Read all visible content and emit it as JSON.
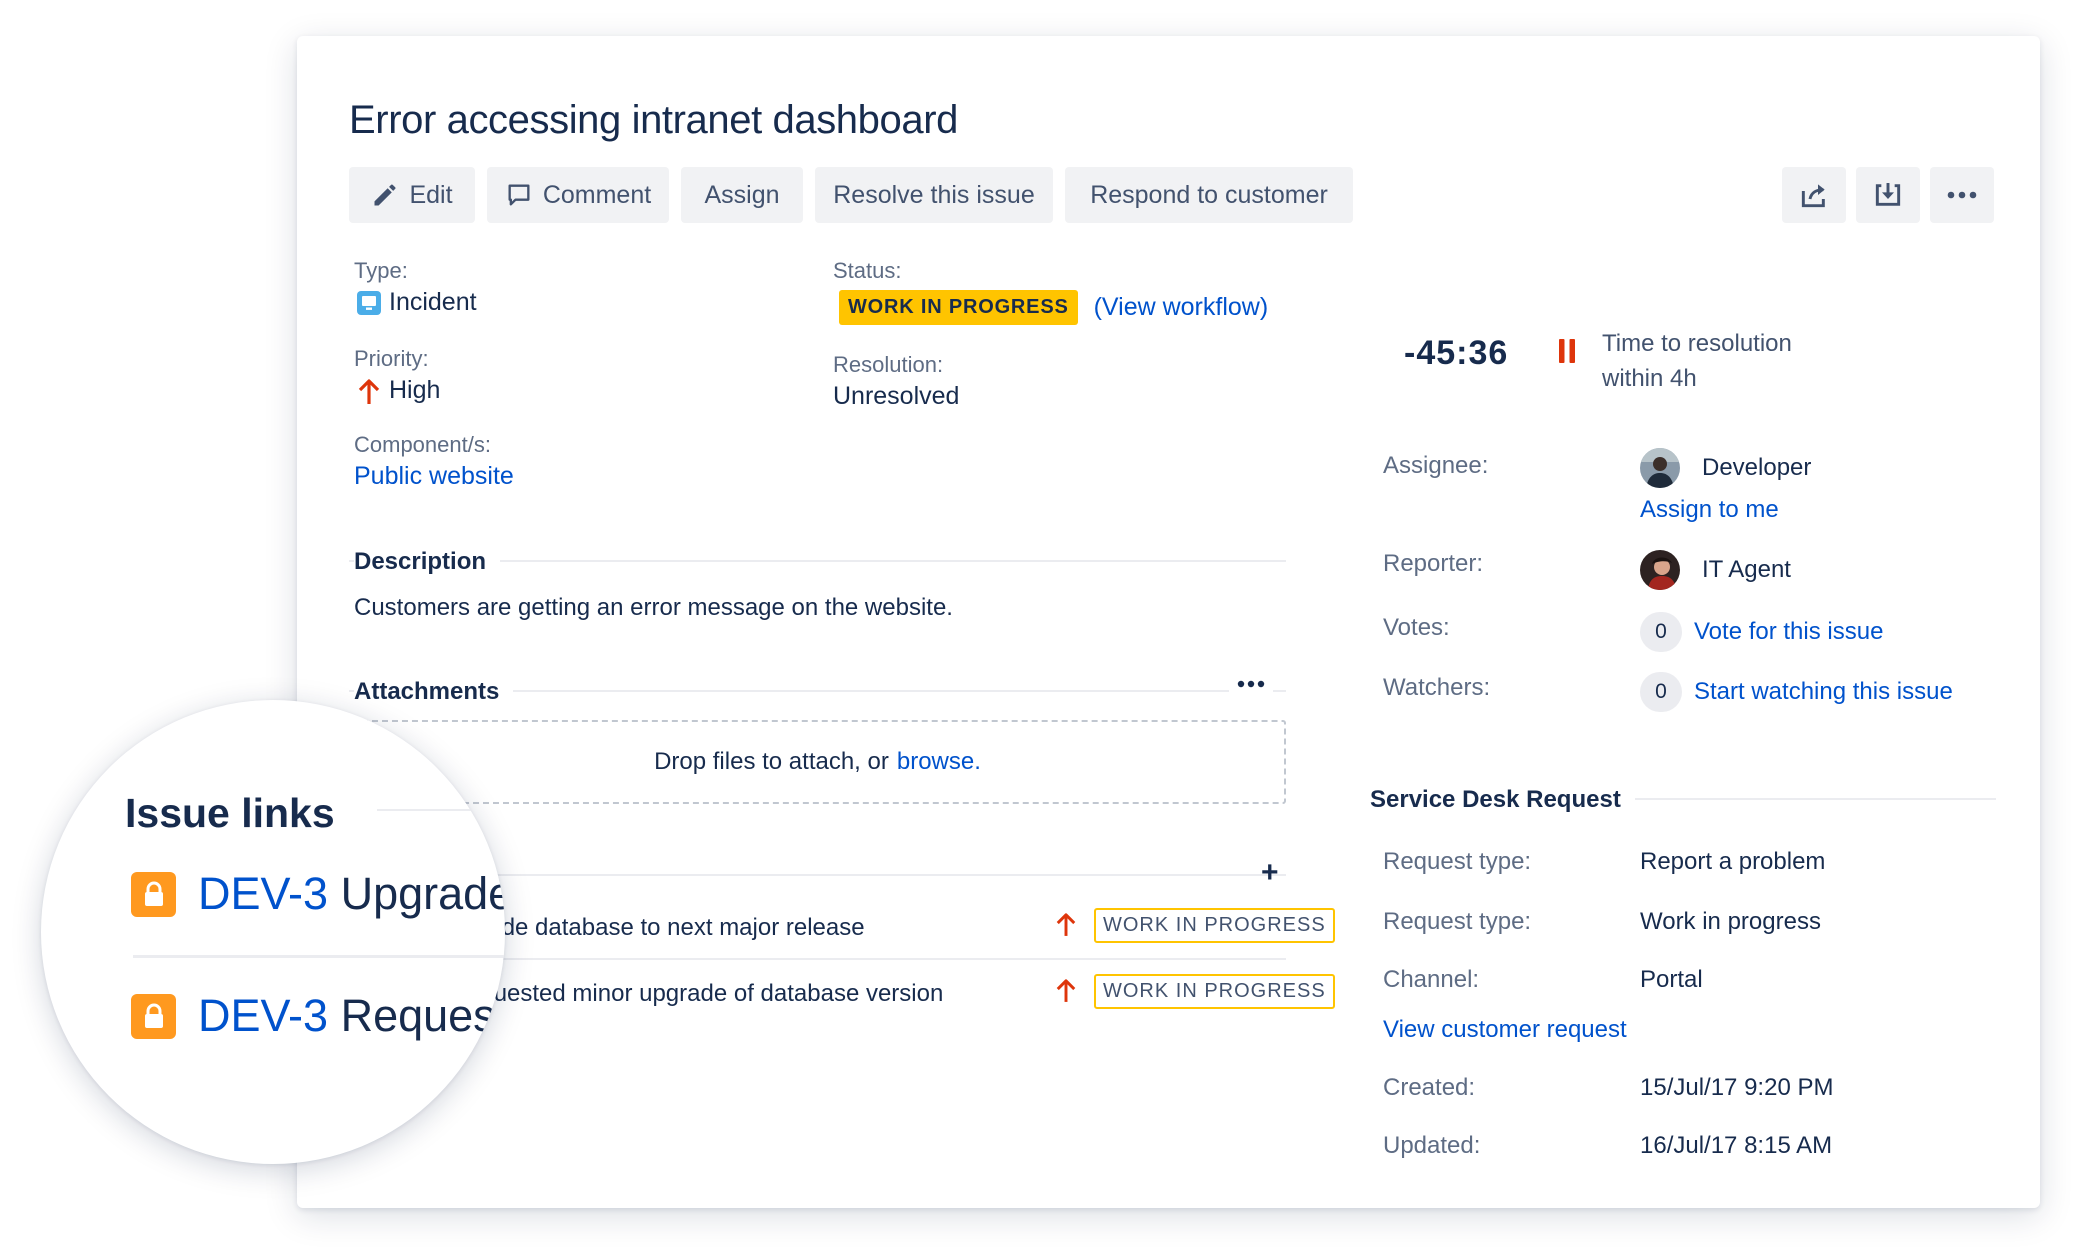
{
  "issue": {
    "title": "Error accessing intranet dashboard"
  },
  "toolbar": {
    "edit": "Edit",
    "comment": "Comment",
    "assign": "Assign",
    "resolve": "Resolve this issue",
    "respond": "Respond to customer"
  },
  "details": {
    "type_label": "Type:",
    "type_value": "Incident",
    "priority_label": "Priority:",
    "priority_value": "High",
    "component_label": "Component/s:",
    "component_value": "Public website",
    "status_label": "Status:",
    "status_value": "WORK IN PROGRESS",
    "view_workflow": "(View workflow)",
    "resolution_label": "Resolution:",
    "resolution_value": "Unresolved"
  },
  "description": {
    "heading": "Description",
    "text": "Customers are getting an error message on the website."
  },
  "attachments": {
    "heading": "Attachments",
    "drop_text": "Drop files to attach, or ",
    "browse": "browse."
  },
  "issue_links": {
    "heading": "Issue links",
    "rows": [
      {
        "key": "DEV-3",
        "summary_zoom": "Upgrade",
        "summary": "grade database to next major release",
        "status": "WORK IN PROGRESS"
      },
      {
        "key": "DEV-3",
        "summary_zoom": "Reques",
        "summary": "equested minor upgrade of database version",
        "status": "WORK IN PROGRESS"
      }
    ]
  },
  "sla": {
    "timer": "-45:36",
    "line1": "Time to resolution",
    "line2": "within 4h"
  },
  "people": {
    "assignee_label": "Assignee:",
    "assignee_value": "Developer",
    "assign_to_me": "Assign to me",
    "reporter_label": "Reporter:",
    "reporter_value": "IT Agent",
    "votes_label": "Votes:",
    "votes_count": "0",
    "vote_link": "Vote for this issue",
    "watchers_label": "Watchers:",
    "watchers_count": "0",
    "watch_link": "Start watching this issue"
  },
  "service_desk": {
    "heading": "Service Desk Request",
    "request_type_label": "Request type:",
    "request_type_value": "Report a problem",
    "request_type2_label": "Request type:",
    "request_type2_value": "Work in progress",
    "channel_label": "Channel:",
    "channel_value": "Portal",
    "view_request": "View customer request",
    "created_label": "Created:",
    "created_value": "15/Jul/17 9:20 PM",
    "updated_label": "Updated:",
    "updated_value": "16/Jul/17 8:15 AM"
  },
  "colors": {
    "link": "#0052cc",
    "status_yellow": "#ffc400",
    "priority_red": "#de350b",
    "incident_blue": "#4bade8",
    "lock_orange": "#ff991f"
  }
}
